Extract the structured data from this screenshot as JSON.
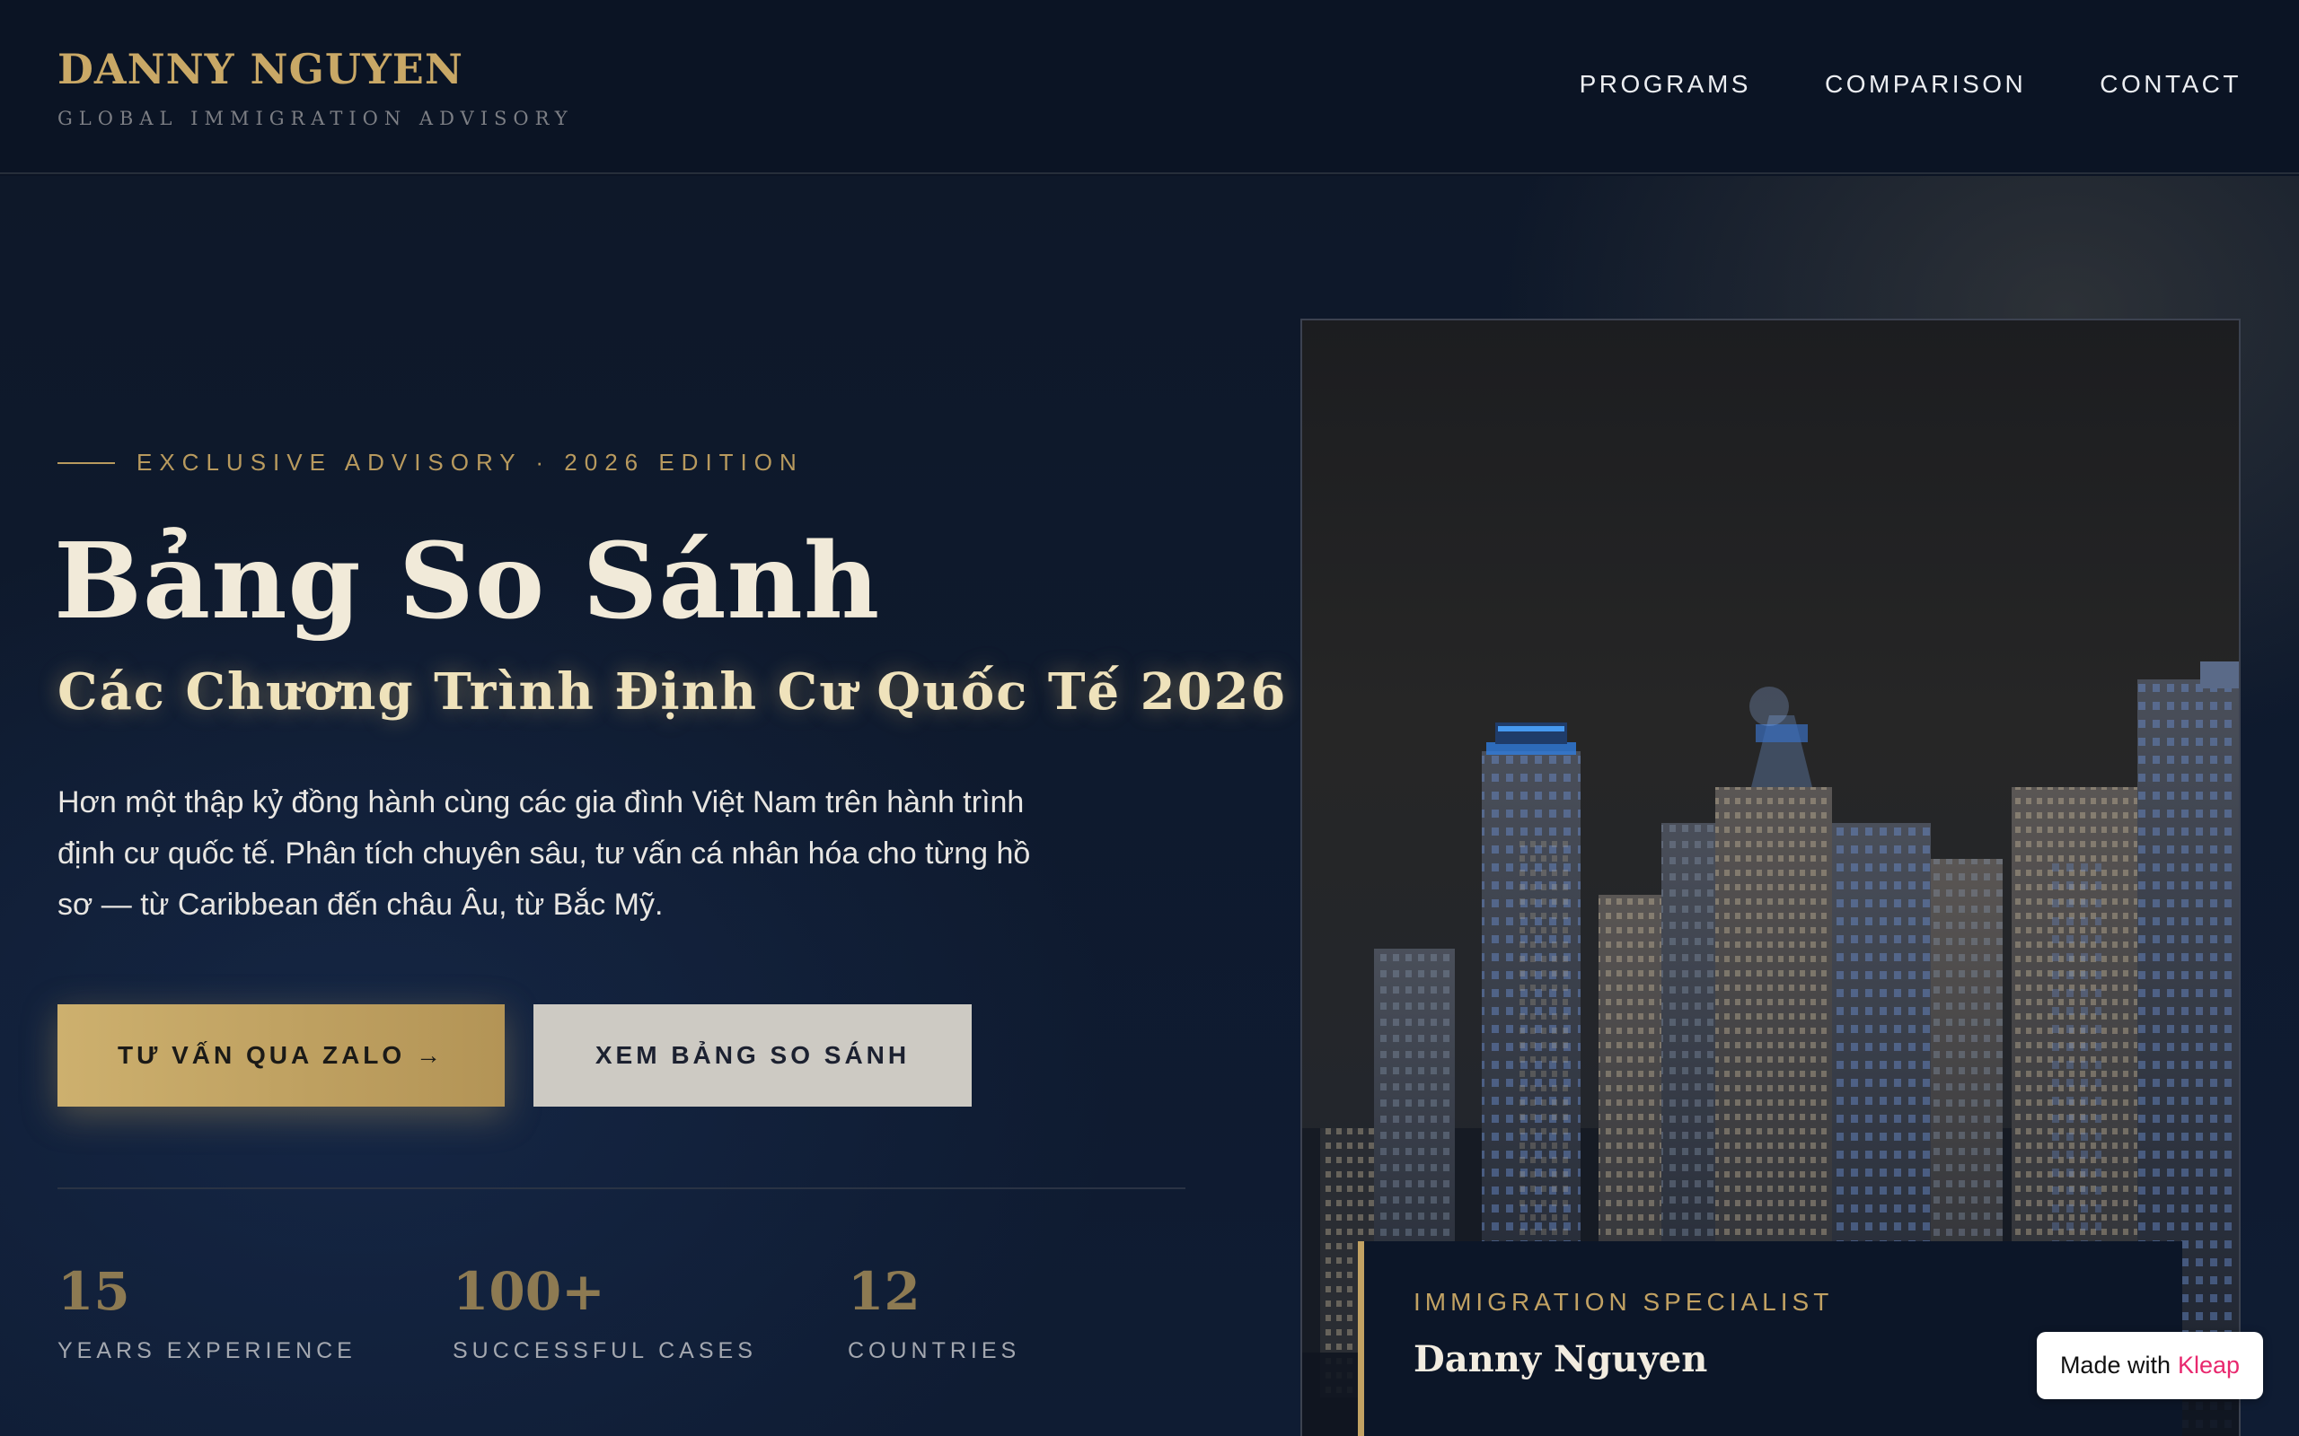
{
  "header": {
    "brand_name": "DANNY NGUYEN",
    "brand_tagline": "GLOBAL IMMIGRATION ADVISORY",
    "nav": [
      "PROGRAMS",
      "COMPARISON",
      "CONTACT"
    ]
  },
  "hero": {
    "eyebrow": "EXCLUSIVE ADVISORY · 2026 EDITION",
    "title": "Bảng So Sánh",
    "subtitle": "Các Chương Trình Định Cư Quốc Tế 2026",
    "description": "Hơn một thập kỷ đồng hành cùng các gia đình Việt Nam trên hành trình định cư quốc tế. Phân tích chuyên sâu, tư vấn cá nhân hóa cho từng hồ sơ — từ Caribbean đến châu Âu, từ Bắc Mỹ.",
    "primary_button": "TƯ VẤN QUA ZALO →",
    "secondary_button": "XEM BẢNG SO SÁNH",
    "stats": [
      {
        "value": "15",
        "label": "YEARS EXPERIENCE"
      },
      {
        "value": "100+",
        "label": "SUCCESSFUL CASES"
      },
      {
        "value": "12",
        "label": "COUNTRIES"
      }
    ]
  },
  "card": {
    "image_subject": "night-city-skyline",
    "specialist_label": "IMMIGRATION SPECIALIST",
    "specialist_name": "Danny Nguyen"
  },
  "badge": {
    "prefix": "Made with",
    "brand": "Kleap"
  },
  "colors": {
    "background": "#0b1424",
    "gold": "#c9a866",
    "cream": "#f1ead9",
    "button_secondary": "#cdcac3"
  }
}
